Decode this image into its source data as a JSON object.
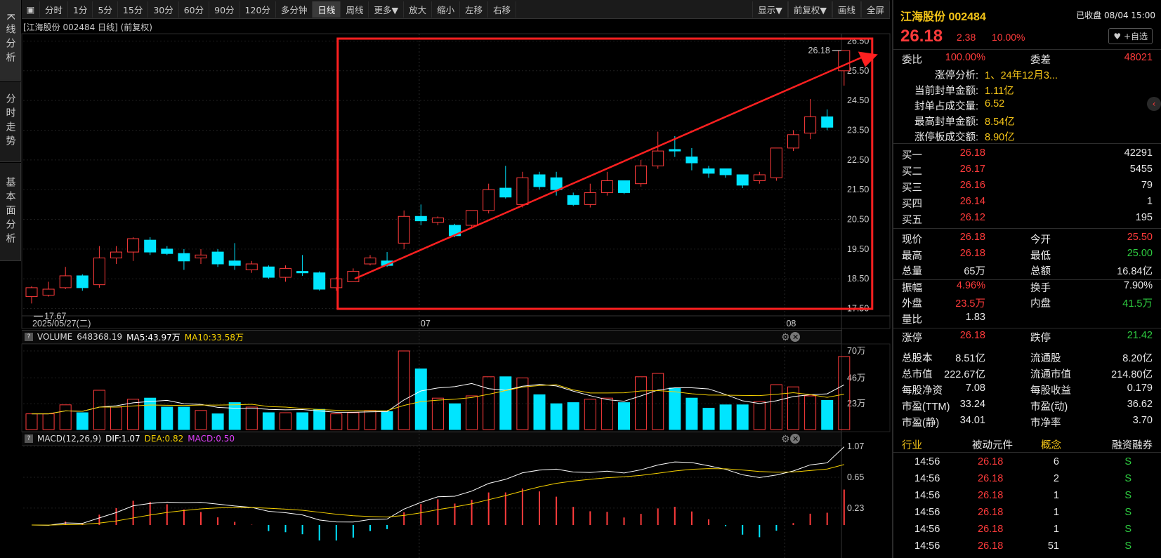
{
  "sidebar": {
    "tabs": [
      {
        "label": "K线分析",
        "active": true
      },
      {
        "label": "分时走势",
        "active": false
      },
      {
        "label": "基本面分析",
        "active": false
      }
    ]
  },
  "toolbar": {
    "periods": [
      "分时",
      "1分",
      "5分",
      "15分",
      "30分",
      "60分",
      "90分",
      "120分",
      "多分钟",
      "日线",
      "周线",
      "更多▼"
    ],
    "active": "日线",
    "actions": [
      "放大",
      "缩小",
      "左移",
      "右移"
    ],
    "right": [
      "显示▼",
      "前复权▼",
      "画线",
      "全屏"
    ]
  },
  "chart": {
    "title": "[江海股份 002484 日线] (前复权)",
    "y_ticks": [
      "26.50",
      "25.50",
      "24.50",
      "23.50",
      "22.50",
      "21.50",
      "20.50",
      "19.50",
      "18.50",
      "17.50"
    ],
    "x_labels": [
      "2025/05/27(二)",
      "07",
      "08"
    ],
    "low_label": "17.67",
    "high_label": "26.18"
  },
  "chart_data": {
    "type": "candlestick",
    "ylim": [
      17.3,
      26.7
    ],
    "candles": [
      [
        17.9,
        18.2,
        17.67,
        18.25
      ],
      [
        17.95,
        18.15,
        17.9,
        18.4
      ],
      [
        18.2,
        18.6,
        18.15,
        18.9
      ],
      [
        18.6,
        18.2,
        18.1,
        18.65
      ],
      [
        18.3,
        19.2,
        18.2,
        19.6
      ],
      [
        19.2,
        19.4,
        19.0,
        19.6
      ],
      [
        19.4,
        19.85,
        19.1,
        19.9
      ],
      [
        19.8,
        19.4,
        19.3,
        19.9
      ],
      [
        19.5,
        19.35,
        19.3,
        19.6
      ],
      [
        19.35,
        19.1,
        18.8,
        19.5
      ],
      [
        19.2,
        19.3,
        19.0,
        19.5
      ],
      [
        19.4,
        19.0,
        18.9,
        19.5
      ],
      [
        19.1,
        18.95,
        18.8,
        19.7
      ],
      [
        18.8,
        19.0,
        18.7,
        19.1
      ],
      [
        18.9,
        18.55,
        18.5,
        18.95
      ],
      [
        18.55,
        18.85,
        18.4,
        18.95
      ],
      [
        18.75,
        18.7,
        18.6,
        19.3
      ],
      [
        18.7,
        18.15,
        18.1,
        18.75
      ],
      [
        18.2,
        18.5,
        18.1,
        18.55
      ],
      [
        18.4,
        18.75,
        18.4,
        18.85
      ],
      [
        19.0,
        19.2,
        18.95,
        19.3
      ],
      [
        19.1,
        18.95,
        18.9,
        19.4
      ],
      [
        19.7,
        20.6,
        19.5,
        20.8
      ],
      [
        20.6,
        20.45,
        20.3,
        21.0
      ],
      [
        20.4,
        20.55,
        20.3,
        20.6
      ],
      [
        20.3,
        19.95,
        19.9,
        20.35
      ],
      [
        20.3,
        20.8,
        20.2,
        20.8
      ],
      [
        20.8,
        21.5,
        20.7,
        21.7
      ],
      [
        21.55,
        21.25,
        21.2,
        22.3
      ],
      [
        21.0,
        21.9,
        20.9,
        22.1
      ],
      [
        22.0,
        21.6,
        21.5,
        22.1
      ],
      [
        21.9,
        21.5,
        21.3,
        22.1
      ],
      [
        21.3,
        21.0,
        20.95,
        21.4
      ],
      [
        21.0,
        21.4,
        20.9,
        21.7
      ],
      [
        21.4,
        21.8,
        21.3,
        22.1
      ],
      [
        21.8,
        21.4,
        21.35,
        21.8
      ],
      [
        21.7,
        22.3,
        21.6,
        22.5
      ],
      [
        22.3,
        22.8,
        22.2,
        23.45
      ],
      [
        22.85,
        22.8,
        22.6,
        23.3
      ],
      [
        22.6,
        22.4,
        22.15,
        22.9
      ],
      [
        22.2,
        22.05,
        21.9,
        22.3
      ],
      [
        22.2,
        22.0,
        21.9,
        22.2
      ],
      [
        22.0,
        21.65,
        21.55,
        22.0
      ],
      [
        21.8,
        22.0,
        21.7,
        22.1
      ],
      [
        21.9,
        22.9,
        21.8,
        22.9
      ],
      [
        22.9,
        23.35,
        22.8,
        23.5
      ],
      [
        23.4,
        23.95,
        23.2,
        24.55
      ],
      [
        23.95,
        23.6,
        23.5,
        24.2
      ],
      [
        25.5,
        26.18,
        25.0,
        26.18
      ]
    ],
    "volume": {
      "label": "VOLUME",
      "value": "648368.19",
      "ma5": "MA5:43.97万",
      "ma10": "MA10:33.58万",
      "y_ticks": [
        "70万",
        "46万",
        "23万"
      ],
      "values": [
        14,
        14,
        22,
        15,
        35,
        20,
        27,
        28,
        20,
        20,
        17,
        14,
        24,
        20,
        15,
        15,
        15,
        18,
        14,
        15,
        17,
        16,
        70,
        54,
        28,
        23,
        30,
        47,
        47,
        46,
        31,
        23,
        24,
        27,
        28,
        24,
        47,
        50,
        37,
        28,
        19,
        22,
        22,
        25,
        40,
        38,
        30,
        26,
        65
      ]
    },
    "macd": {
      "label": "MACD(12,26,9)",
      "dif": "DIF:1.07",
      "dea": "DEA:0.82",
      "macd": "MACD:0.50",
      "y_ticks": [
        "1.07",
        "0.65",
        "0.23"
      ]
    }
  },
  "annotation": {
    "color": "#ff2020"
  },
  "right_panel": {
    "name": "江海股份 002484",
    "status": "已收盘 08/04 15:00",
    "price": "26.18",
    "change": "2.38",
    "pct": "10.00%",
    "watch": "+自选",
    "webi": {
      "label": "委比",
      "value": "100.00%",
      "label2": "委差",
      "value2": "48021"
    },
    "limit_info": [
      [
        "涨停分析:",
        "1、24年12月3..."
      ],
      [
        "当前封单金额:",
        "1.11亿"
      ],
      [
        "封单占成交量:",
        "6.52"
      ],
      [
        "最高封单金额:",
        "8.54亿"
      ],
      [
        "涨停板成交额:",
        "8.90亿"
      ]
    ],
    "bids": [
      [
        "买一",
        "26.18",
        "42291"
      ],
      [
        "买二",
        "26.17",
        "5455"
      ],
      [
        "买三",
        "26.16",
        "79"
      ],
      [
        "买四",
        "26.14",
        "1"
      ],
      [
        "买五",
        "26.12",
        "195"
      ]
    ],
    "quote": [
      [
        "现价",
        "26.18",
        "今开",
        "25.50"
      ],
      [
        "最高",
        "26.18",
        "最低",
        "25.00"
      ],
      [
        "总量",
        "65万",
        "总额",
        "16.84亿"
      ],
      [
        "振幅",
        "4.96%",
        "换手",
        "7.90%"
      ],
      [
        "外盘",
        "23.5万",
        "内盘",
        "41.5万"
      ],
      [
        "量比",
        "1.83",
        "",
        ""
      ],
      [
        "涨停",
        "26.18",
        "跌停",
        "21.42"
      ]
    ],
    "fundamentals": [
      [
        "总股本",
        "8.51亿",
        "流通股",
        "8.20亿"
      ],
      [
        "总市值",
        "222.67亿",
        "流通市值",
        "214.80亿"
      ],
      [
        "每股净资",
        "7.08",
        "每股收益",
        "0.179"
      ],
      [
        "市盈(TTM)",
        "33.24",
        "市盈(动)",
        "36.62"
      ],
      [
        "市盈(静)",
        "34.01",
        "市净率",
        "3.70"
      ]
    ],
    "tags": [
      "行业",
      "被动元件",
      "概念",
      "融资融券"
    ],
    "ticks": [
      [
        "14:56",
        "26.18",
        "6",
        "S"
      ],
      [
        "14:56",
        "26.18",
        "2",
        "S"
      ],
      [
        "14:56",
        "26.18",
        "1",
        "S"
      ],
      [
        "14:56",
        "26.18",
        "1",
        "S"
      ],
      [
        "14:56",
        "26.18",
        "1",
        "S"
      ],
      [
        "14:56",
        "26.18",
        "51",
        "S"
      ]
    ]
  }
}
